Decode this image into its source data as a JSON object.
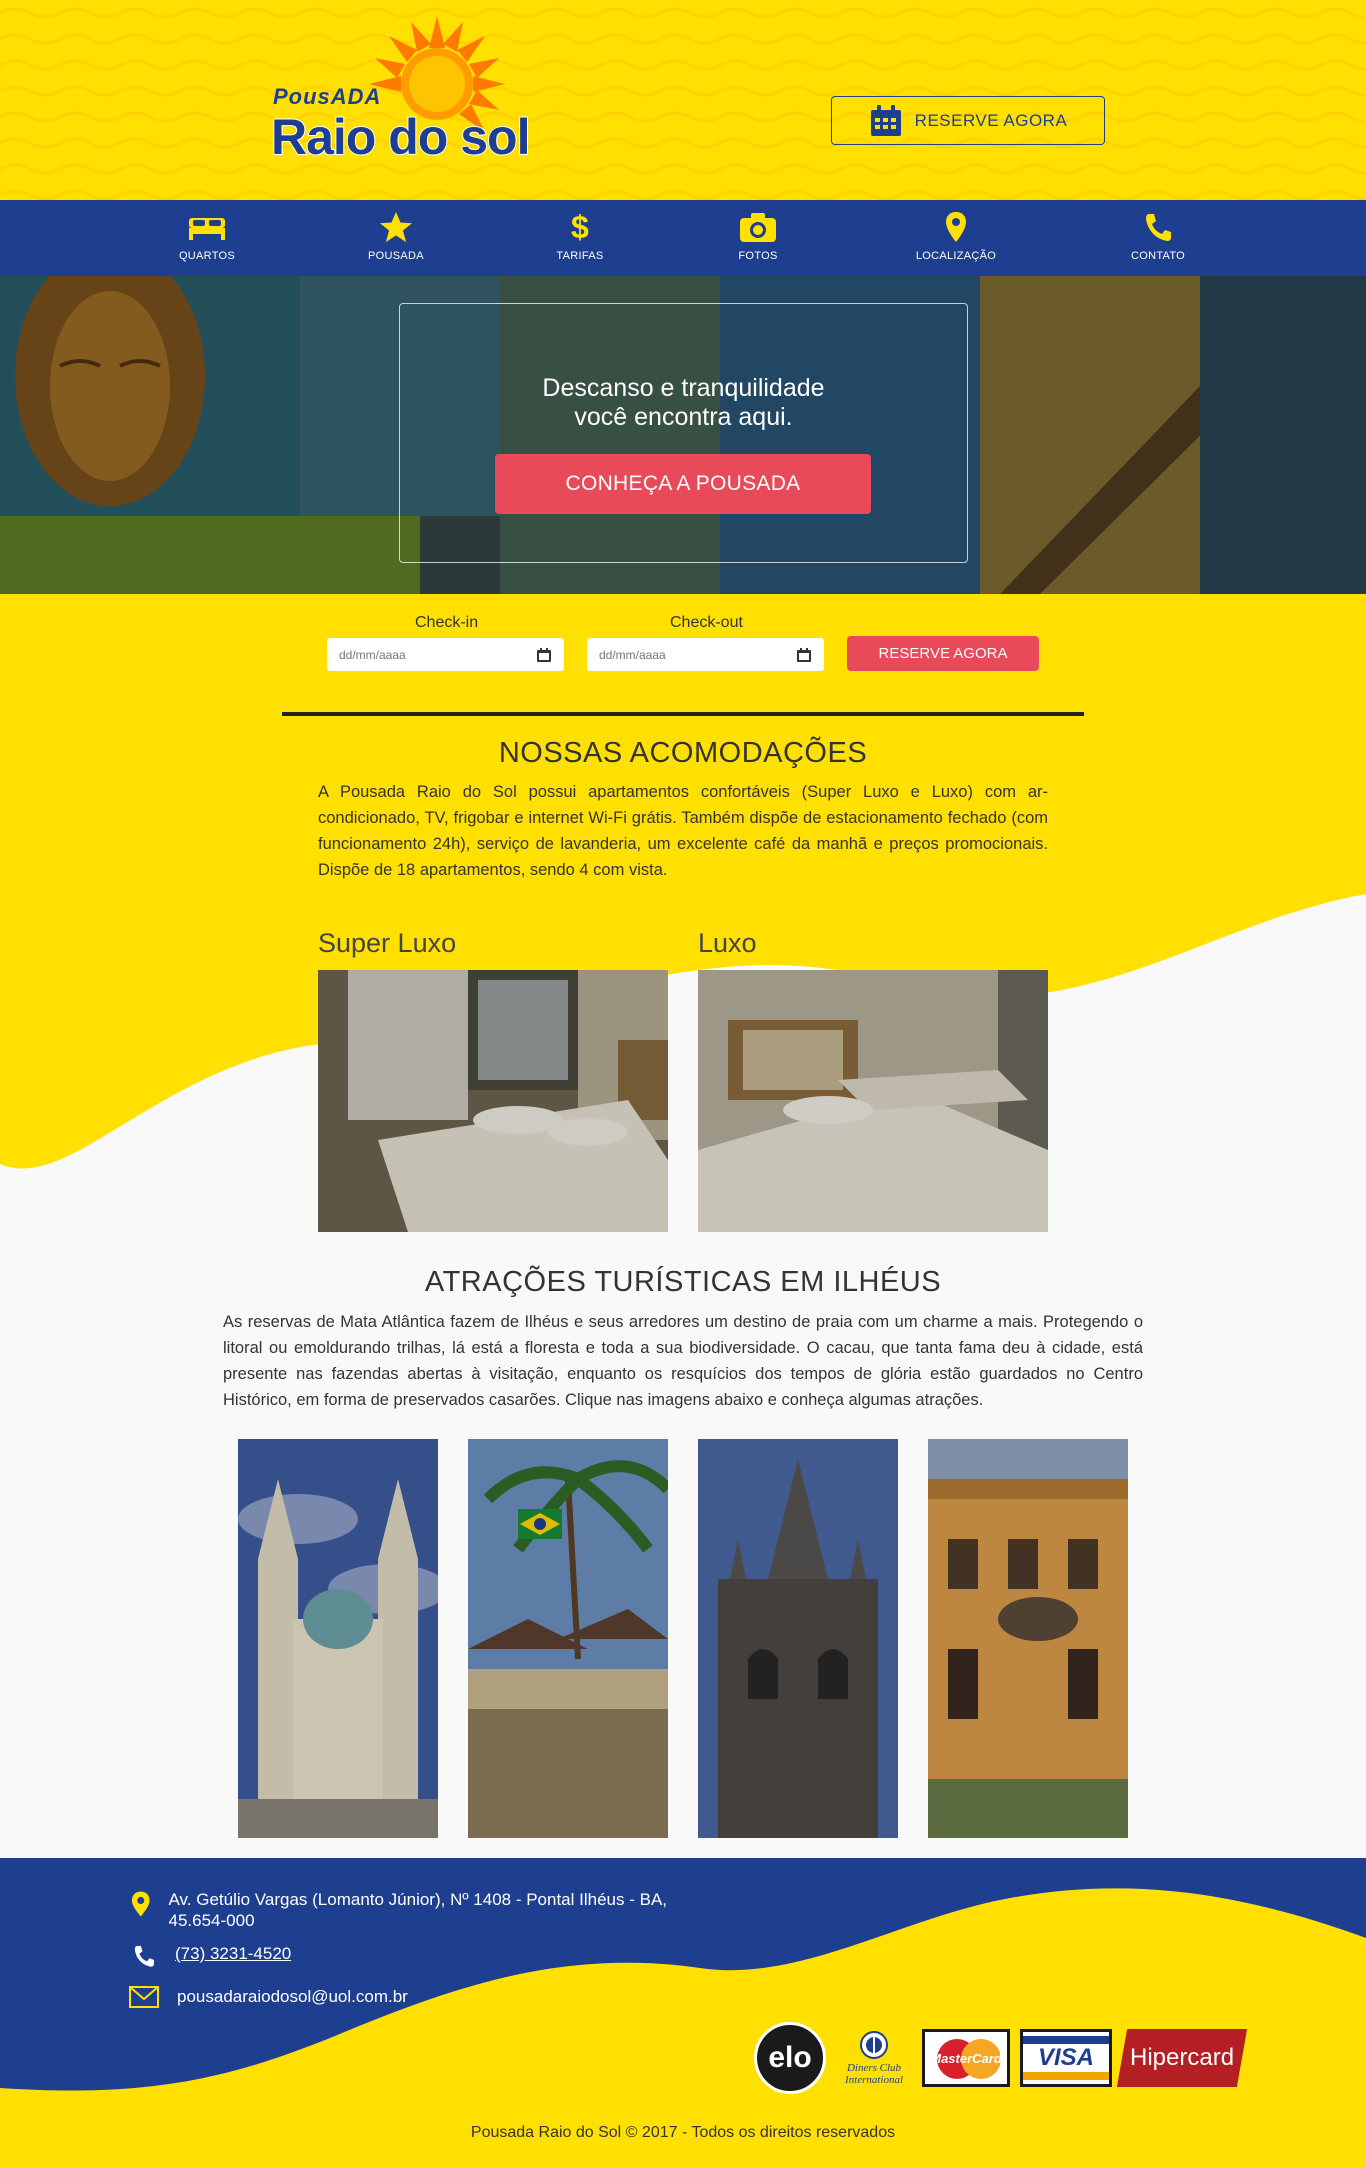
{
  "colors": {
    "yellow": "#ffe000",
    "navy": "#1e3f8f",
    "accent": "#e84a5a"
  },
  "logo": {
    "small": "PousADA",
    "main": "Raio do sol"
  },
  "header": {
    "reserve_label": "RESERVE AGORA",
    "reserve_icon": "calendar-icon"
  },
  "nav": [
    {
      "label": "QUARTOS",
      "icon": "bed-icon"
    },
    {
      "label": "POUSADA",
      "icon": "star-icon"
    },
    {
      "label": "TARIFAS",
      "icon": "dollar-icon"
    },
    {
      "label": "FOTOS",
      "icon": "camera-icon"
    },
    {
      "label": "LOCALIZAÇÃO",
      "icon": "map-pin-icon"
    },
    {
      "label": "CONTATO",
      "icon": "phone-icon"
    }
  ],
  "hero": {
    "line1": "Descanso e tranquilidade",
    "line2": "você encontra aqui.",
    "button": "CONHEÇA A POUSADA"
  },
  "booking": {
    "checkin_label": "Check-in",
    "checkin_placeholder": "dd/mm/aaaa",
    "checkout_label": "Check-out",
    "checkout_placeholder": "dd/mm/aaaa",
    "button": "RESERVE AGORA"
  },
  "accommodations": {
    "title": "NOSSAS ACOMODAÇÕES",
    "text": "A Pousada Raio do Sol possui apartamentos confortáveis (Super Luxo e Luxo) com ar-condicionado, TV, frigobar e internet Wi-Fi grátis. Também dispõe de estacionamento fechado (com funcionamento 24h), serviço de lavanderia, um excelente café da manhã e preços promocionais. Dispõe de 18 apartamentos, sendo 4 com vista.",
    "rooms": [
      {
        "name": "Super Luxo"
      },
      {
        "name": "Luxo"
      }
    ]
  },
  "attractions": {
    "title": "ATRAÇÕES TURÍSTICAS EM ILHÉUS",
    "text": "As reservas de Mata Atlântica fazem de Ilhéus e seus arredores um destino de praia com um charme a mais. Protegendo o litoral ou emoldurando trilhas, lá está a floresta e toda a sua biodiversidade. O cacau, que tanta fama deu à cidade, está presente nas fazendas abertas à visitação, enquanto os resquícios dos tempos de glória estão guardados no Centro Histórico, em forma de preservados casarões. Clique nas imagens abaixo e conheça algumas atrações."
  },
  "footer": {
    "address": "Av. Getúlio Vargas (Lomanto Júnior), Nº 1408 - Pontal Ilhéus - BA, 45.654-000",
    "phone": "(73) 3231-4520",
    "email": "pousadaraiodosol@uol.com.br",
    "cards": {
      "elo": "elo",
      "diners_line1": "Diners Club",
      "diners_line2": "International",
      "mastercard": "MasterCard",
      "visa": "VISA",
      "hipercard": "Hipercard"
    },
    "copyright": "Pousada Raio do Sol © 2017 - Todos os direitos reservados"
  }
}
